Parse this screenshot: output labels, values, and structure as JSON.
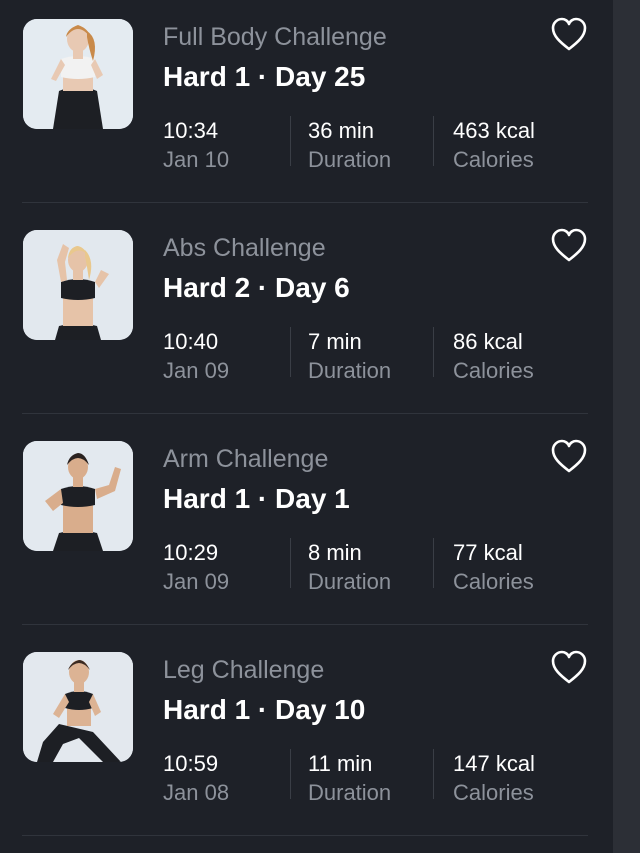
{
  "workouts": [
    {
      "title": "Full Body Challenge",
      "level": "Hard 1 · Day 25",
      "time": "10:34",
      "date": "Jan 10",
      "duration": "36 min",
      "duration_label": "Duration",
      "calories": "463 kcal",
      "calories_label": "Calories",
      "favorite": false
    },
    {
      "title": "Abs Challenge",
      "level": "Hard 2 · Day 6",
      "time": "10:40",
      "date": "Jan 09",
      "duration": "7 min",
      "duration_label": "Duration",
      "calories": "86 kcal",
      "calories_label": "Calories",
      "favorite": false
    },
    {
      "title": "Arm Challenge",
      "level": "Hard 1 · Day 1",
      "time": "10:29",
      "date": "Jan 09",
      "duration": "8 min",
      "duration_label": "Duration",
      "calories": "77 kcal",
      "calories_label": "Calories",
      "favorite": false
    },
    {
      "title": "Leg Challenge",
      "level": "Hard 1 · Day 10",
      "time": "10:59",
      "date": "Jan 08",
      "duration": "11 min",
      "duration_label": "Duration",
      "calories": "147 kcal",
      "calories_label": "Calories",
      "favorite": false
    }
  ],
  "colors": {
    "background": "#1e2128",
    "primary_text": "#ffffff",
    "secondary_text": "#8d929b",
    "divider": "#30343c"
  },
  "icons": {
    "favorite": "heart-outline-icon"
  }
}
